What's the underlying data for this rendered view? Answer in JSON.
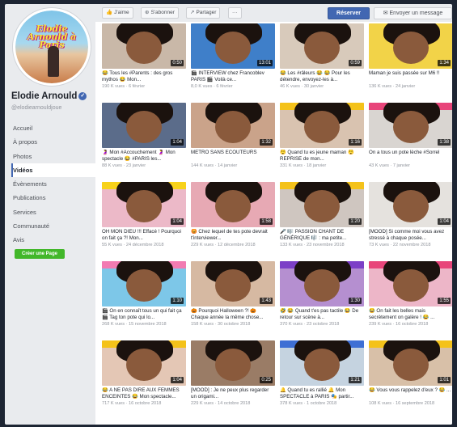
{
  "page": {
    "name": "Elodie Arnould",
    "handle": "@elodiearnouldjoue",
    "avatar_text": "Elodie Arnould à Paris",
    "create_page": "Créer une Page"
  },
  "nav": [
    {
      "label": "Accueil",
      "active": false
    },
    {
      "label": "À propos",
      "active": false
    },
    {
      "label": "Photos",
      "active": false
    },
    {
      "label": "Vidéos",
      "active": true
    },
    {
      "label": "Évènements",
      "active": false
    },
    {
      "label": "Publications",
      "active": false
    },
    {
      "label": "Services",
      "active": false
    },
    {
      "label": "Communauté",
      "active": false
    },
    {
      "label": "Avis",
      "active": false
    }
  ],
  "toolbar": {
    "like": "J'aime",
    "follow": "S'abonner",
    "share": "Partager",
    "more": "···",
    "reserve": "Réserver",
    "message": "Envoyer un message"
  },
  "colors": {
    "facebook_blue": "#4267b2",
    "create_green": "#42b72a"
  },
  "videos": [
    {
      "title": "😂 Tous les #Parents : des gros mythos 😂 Mon...",
      "meta": "190 K vues · 6 février",
      "duration": "0:50",
      "bg": "#c9b8a8",
      "band": ""
    },
    {
      "title": "🎬 INTERVIEW chez Francoblev PARIS 🎬 Voilà ce...",
      "meta": "8,0 K vues · 6 février",
      "duration": "13:01",
      "bg": "#3f7fc9",
      "band": ""
    },
    {
      "title": "😂 Les #râleurs 😂 😂 Pour les détendre, envoyez-les à...",
      "meta": "46 K vues · 30 janvier",
      "duration": "0:59",
      "bg": "#d8cabb",
      "band": ""
    },
    {
      "title": "Maman je suis passée sur M6 !!",
      "meta": "136 K vues · 24 janvier",
      "duration": "1:34",
      "bg": "#f2d348",
      "band": ""
    },
    {
      "title": "🤰 Mon #Accouchement 🤰 Mon spectacle 😂 #PARIS les...",
      "meta": "88 K vues · 23 janvier",
      "duration": "1:04",
      "bg": "#5b6c8a",
      "band": ""
    },
    {
      "title": "METRO SANS ECOUTEURS",
      "meta": "144 K vues · 14 janvier",
      "duration": "1:32",
      "bg": "#caa38a",
      "band": ""
    },
    {
      "title": "😲 Quand tu es jeune maman 😲 REPRISE de mon...",
      "meta": "331 K vues · 18 janvier",
      "duration": "1:16",
      "bg": "#d9c3b0",
      "band": "#f4c21a"
    },
    {
      "title": "On a tous un pote lèche #Sorrel",
      "meta": "43 K vues · 7 janvier",
      "duration": "1:38",
      "bg": "#d9d5d1",
      "band": "#e8457a"
    },
    {
      "title": "OH MON DIEU !!! Effacé ! Pourquoi on fait ça ?! Mon...",
      "meta": "55 K vues · 24 décembre 2018",
      "duration": "1:04",
      "bg": "#ecb9c8",
      "band": "#f7d21a"
    },
    {
      "title": "😡 Chez lequel de tes pote devrait t'interviewer...",
      "meta": "229 K vues · 12 décembre 2018",
      "duration": "1:58",
      "bg": "#e7a9b4",
      "band": ""
    },
    {
      "title": "🎤 🎼 PASSION CHANT DE GÉNÉRIQUE 🎼 : ma petite...",
      "meta": "133 K vues · 23 novembre 2018",
      "duration": "1:20",
      "bg": "#cfc6c0",
      "band": "#f4c21a"
    },
    {
      "title": "[MOOD] Si comme moi vous avez stressé à chaque posée...",
      "meta": "73 K vues · 22 novembre 2018",
      "duration": "1:04",
      "bg": "#e5e2de",
      "band": ""
    },
    {
      "title": "🎬 On en connaît tous un qui fait ça 🎬 Tag ton pote qui lo...",
      "meta": "268 K vues · 15 novembre 2018",
      "duration": "1:10",
      "bg": "#7dc7e8",
      "band": "#f27bb2"
    },
    {
      "title": "🎃 Pourquoi Halloween ?! 🎃 Chaque année la même chose...",
      "meta": "158 K vues · 30 octobre 2018",
      "duration": "1:43",
      "bg": "#d6b9a2",
      "band": ""
    },
    {
      "title": "🤣 😂 Quand t'es pas tactile 😂 De retour sur scène à...",
      "meta": "370 K vues · 23 octobre 2018",
      "duration": "1:30",
      "bg": "#b58fd0",
      "band": "#7c3fc7"
    },
    {
      "title": "😂 On fait les belles mais secrètement on galère ! 😂 ...",
      "meta": "239 K vues · 16 octobre 2018",
      "duration": "1:55",
      "bg": "#edb6c8",
      "band": "#e8457a"
    },
    {
      "title": "😂 A NE PAS DIRE AUX FEMMES ENCEINTES 😂 Mon spectacle...",
      "meta": "717 K vues · 16 octobre 2018",
      "duration": "1:04",
      "bg": "#e4c7b5",
      "band": "#f4c21a"
    },
    {
      "title": "[MOOD] : Je ne peux plus regarder un origami...",
      "meta": "229 K vues · 14 octobre 2018",
      "duration": "0:25",
      "bg": "#9a7c66",
      "band": ""
    },
    {
      "title": "🔔 Quand tu es rallié 🔔 Mon SPECTACLE à PARIS 🎭 partir...",
      "meta": "378 K vues · 1 octobre 2018",
      "duration": "1:21",
      "bg": "#c5d3e0",
      "band": "#3e6fd4"
    },
    {
      "title": "😂 Vous vous rappelez d'eux ? 😂 ...",
      "meta": "108 K vues · 16 septembre 2018",
      "duration": "1:01",
      "bg": "#d8c0a8",
      "band": "#f4c21a"
    }
  ]
}
